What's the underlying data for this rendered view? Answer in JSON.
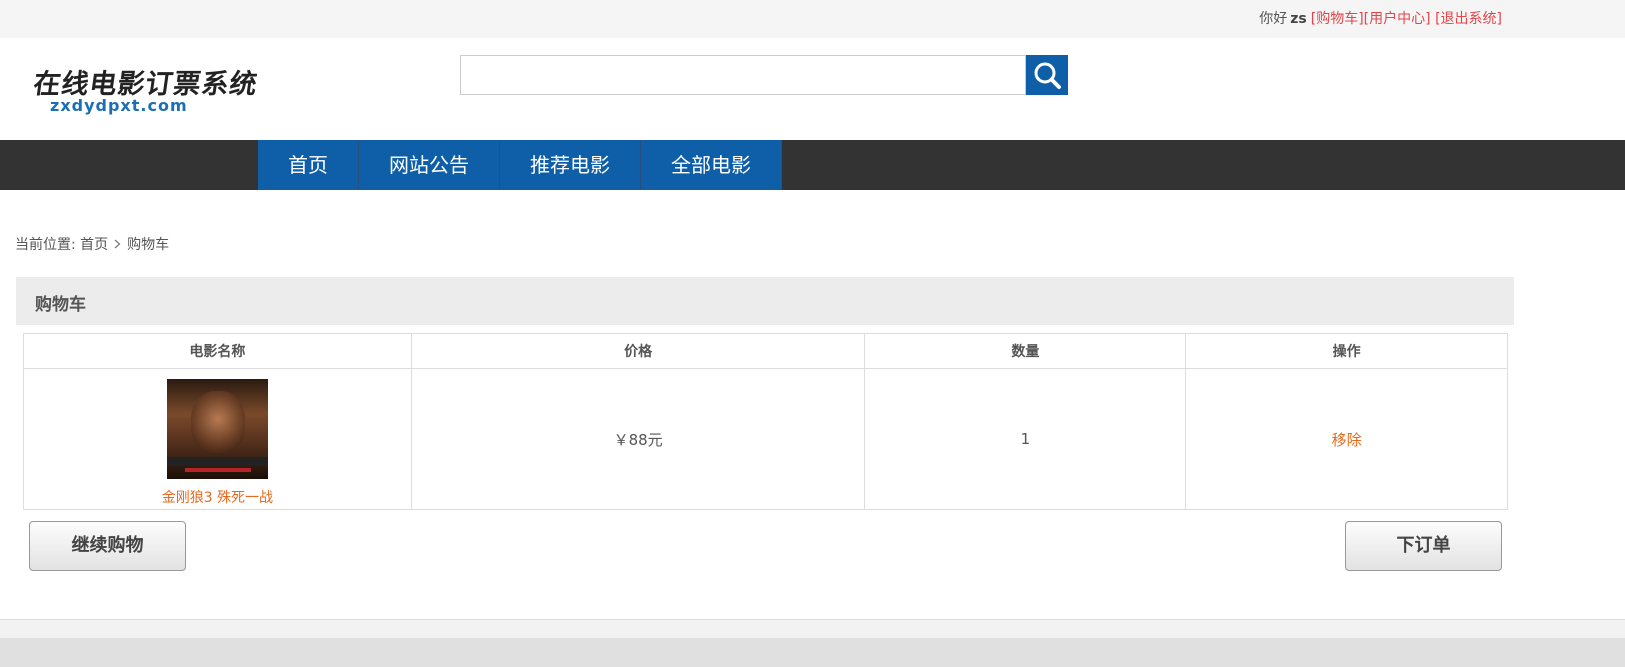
{
  "topbar": {
    "greeting": "你好",
    "username": "zs",
    "cart_link": "[购物车]",
    "user_center_link": "[用户中心]",
    "logout_link": "[退出系统]"
  },
  "logo": {
    "title": "在线电影订票系统",
    "domain": "zxdydpxt.com"
  },
  "search": {
    "value": "",
    "icon": "search-icon",
    "button_color": "#0f5ea8"
  },
  "nav": {
    "items": [
      {
        "label": "首页"
      },
      {
        "label": "网站公告"
      },
      {
        "label": "推荐电影"
      },
      {
        "label": "全部电影"
      }
    ]
  },
  "breadcrumb": {
    "prefix": "当前位置:",
    "home": "首页",
    "current": "购物车"
  },
  "panel": {
    "title": "购物车"
  },
  "table": {
    "headers": [
      "电影名称",
      "价格",
      "数量",
      "操作"
    ],
    "rows": [
      {
        "name": "金刚狼3 殊死一战",
        "price": "￥88元",
        "quantity": "1",
        "action": "移除"
      }
    ]
  },
  "actions": {
    "continue_label": "继续购物",
    "order_label": "下订单"
  },
  "colors": {
    "accent": "#0f5ea8",
    "link_red": "#e4454a",
    "link_orange": "#e66a1e",
    "nav_bg": "#333333"
  }
}
